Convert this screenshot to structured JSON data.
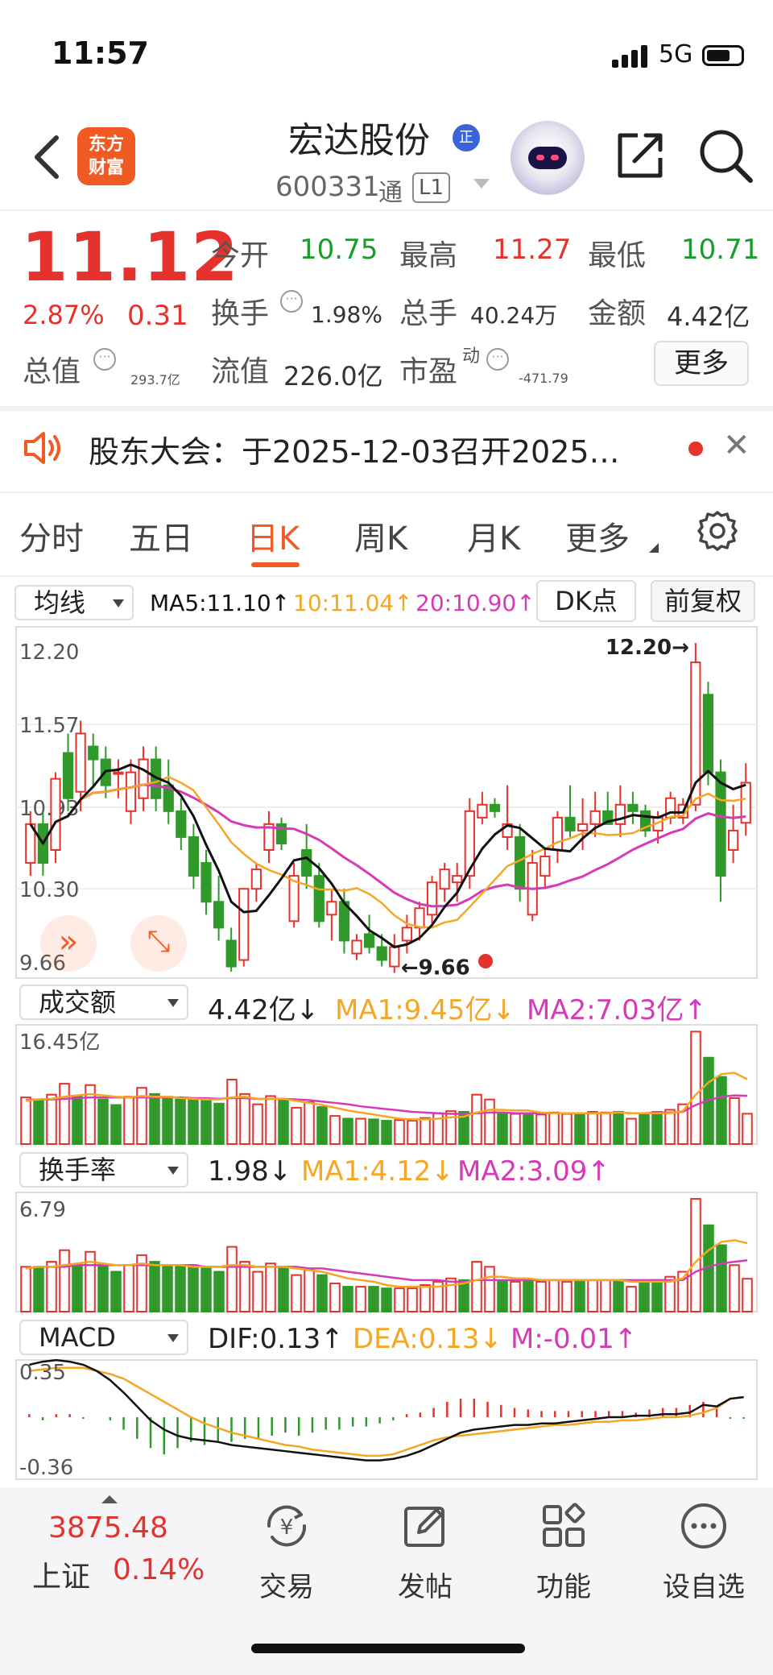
{
  "status_bar": {
    "time": "11:57",
    "network": "5G"
  },
  "header": {
    "logo_text_line1": "东方",
    "logo_text_line2": "财富",
    "stock_name": "宏达股份",
    "badge": "正",
    "stock_code": "600331",
    "tong_label": "通",
    "level_label": "L1"
  },
  "quote": {
    "price": "11.12",
    "change_pct": "2.87%",
    "change_amt": "0.31",
    "open_label": "今开",
    "open_value": "10.75",
    "high_label": "最高",
    "high_value": "11.27",
    "low_label": "最低",
    "low_value": "10.71",
    "turnover_label": "换手",
    "turnover_value": "1.98%",
    "volume_label": "总手",
    "volume_value": "40.24万",
    "amount_label": "金额",
    "amount_value": "4.42亿",
    "mktcap_label": "总值",
    "mktcap_value": "293.7亿",
    "float_label": "流值",
    "float_value": "226.0亿",
    "pe_label": "市盈",
    "pe_sup": "动",
    "pe_value": "-471.79",
    "more_button": "更多"
  },
  "notice": {
    "text": "股东大会：于2025-12-03召开2025…"
  },
  "tabs": [
    {
      "label": "分时",
      "active": false
    },
    {
      "label": "五日",
      "active": false
    },
    {
      "label": "日K",
      "active": true
    },
    {
      "label": "周K",
      "active": false
    },
    {
      "label": "月K",
      "active": false
    },
    {
      "label": "更多",
      "active": false
    }
  ],
  "kline_legend": {
    "selector": "均线",
    "ma5": "MA5:11.10↑",
    "ma10": "10:11.04↑",
    "ma20": "20:10.90↑",
    "dk_button": "DK点",
    "fq_button": "前复权"
  },
  "volume_legend": {
    "selector": "成交额",
    "value": "4.42亿↓",
    "ma1": "MA1:9.45亿↓",
    "ma2": "MA2:7.03亿↑"
  },
  "turnover_legend": {
    "selector": "换手率",
    "value": "1.98↓",
    "ma1": "MA1:4.12↓",
    "ma2": "MA2:3.09↑"
  },
  "macd_legend": {
    "selector": "MACD",
    "dif": "DIF:0.13↑",
    "dea": "DEA:0.13↓",
    "m": "M:-0.01↑"
  },
  "colors": {
    "up": "#e5322d",
    "down": "#2f9a2a",
    "ma5": "#111111",
    "ma10": "#f5a623",
    "ma20": "#d63ab6",
    "accent": "#f25a23"
  },
  "chart_data": [
    {
      "type": "candlestick",
      "y_ticks": [
        "12.20",
        "11.57",
        "10.93",
        "10.30",
        "9.66"
      ],
      "ylim": [
        9.66,
        12.2
      ],
      "annotations": {
        "high": "12.20→",
        "low": "←9.66"
      },
      "candles": [
        {
          "o": 10.5,
          "h": 10.9,
          "l": 10.4,
          "c": 10.8
        },
        {
          "o": 10.8,
          "h": 10.9,
          "l": 10.4,
          "c": 10.5
        },
        {
          "o": 10.6,
          "h": 11.2,
          "l": 10.5,
          "c": 11.15
        },
        {
          "o": 11.35,
          "h": 11.5,
          "l": 10.9,
          "c": 11.0
        },
        {
          "o": 11.05,
          "h": 11.6,
          "l": 10.9,
          "c": 11.5
        },
        {
          "o": 11.4,
          "h": 11.5,
          "l": 11.1,
          "c": 11.3
        },
        {
          "o": 11.3,
          "h": 11.4,
          "l": 11.0,
          "c": 11.1
        },
        {
          "o": 11.2,
          "h": 11.3,
          "l": 11.0,
          "c": 11.2
        },
        {
          "o": 10.9,
          "h": 11.3,
          "l": 10.8,
          "c": 11.2
        },
        {
          "o": 11.0,
          "h": 11.4,
          "l": 10.9,
          "c": 11.3
        },
        {
          "o": 11.3,
          "h": 11.4,
          "l": 10.9,
          "c": 11.0
        },
        {
          "o": 11.1,
          "h": 11.3,
          "l": 10.8,
          "c": 10.9
        },
        {
          "o": 10.9,
          "h": 11.0,
          "l": 10.6,
          "c": 10.7
        },
        {
          "o": 10.7,
          "h": 10.8,
          "l": 10.3,
          "c": 10.4
        },
        {
          "o": 10.5,
          "h": 10.6,
          "l": 10.1,
          "c": 10.2
        },
        {
          "o": 10.2,
          "h": 10.4,
          "l": 9.9,
          "c": 10.0
        },
        {
          "o": 9.9,
          "h": 10.0,
          "l": 9.66,
          "c": 9.7
        },
        {
          "o": 9.75,
          "h": 10.2,
          "l": 9.7,
          "c": 10.3
        },
        {
          "o": 10.3,
          "h": 10.5,
          "l": 10.2,
          "c": 10.45
        },
        {
          "o": 10.6,
          "h": 10.9,
          "l": 10.5,
          "c": 10.8
        },
        {
          "o": 10.8,
          "h": 10.85,
          "l": 10.6,
          "c": 10.65
        },
        {
          "o": 10.05,
          "h": 10.5,
          "l": 10.0,
          "c": 10.4
        },
        {
          "o": 10.6,
          "h": 10.8,
          "l": 10.3,
          "c": 10.4
        },
        {
          "o": 10.4,
          "h": 10.5,
          "l": 10.0,
          "c": 10.05
        },
        {
          "o": 10.1,
          "h": 10.3,
          "l": 9.9,
          "c": 10.2
        },
        {
          "o": 10.2,
          "h": 10.3,
          "l": 9.8,
          "c": 9.9
        },
        {
          "o": 9.8,
          "h": 9.95,
          "l": 9.75,
          "c": 9.9
        },
        {
          "o": 9.95,
          "h": 10.1,
          "l": 9.8,
          "c": 9.85
        },
        {
          "o": 9.85,
          "h": 9.95,
          "l": 9.7,
          "c": 9.75
        },
        {
          "o": 9.7,
          "h": 9.95,
          "l": 9.65,
          "c": 9.85
        },
        {
          "o": 9.9,
          "h": 10.1,
          "l": 9.8,
          "c": 10.0
        },
        {
          "o": 10.0,
          "h": 10.2,
          "l": 9.9,
          "c": 10.15
        },
        {
          "o": 10.1,
          "h": 10.4,
          "l": 10.0,
          "c": 10.35
        },
        {
          "o": 10.3,
          "h": 10.5,
          "l": 10.2,
          "c": 10.45
        },
        {
          "o": 10.35,
          "h": 10.5,
          "l": 10.2,
          "c": 10.4
        },
        {
          "o": 10.4,
          "h": 11.0,
          "l": 10.3,
          "c": 10.9
        },
        {
          "o": 10.85,
          "h": 11.05,
          "l": 10.8,
          "c": 10.95
        },
        {
          "o": 10.95,
          "h": 11.0,
          "l": 10.85,
          "c": 10.9
        },
        {
          "o": 10.7,
          "h": 11.1,
          "l": 10.6,
          "c": 10.8
        },
        {
          "o": 10.7,
          "h": 10.8,
          "l": 10.2,
          "c": 10.3
        },
        {
          "o": 10.1,
          "h": 10.6,
          "l": 10.05,
          "c": 10.5
        },
        {
          "o": 10.4,
          "h": 10.6,
          "l": 10.3,
          "c": 10.55
        },
        {
          "o": 10.6,
          "h": 10.9,
          "l": 10.5,
          "c": 10.85
        },
        {
          "o": 10.85,
          "h": 11.1,
          "l": 10.7,
          "c": 10.75
        },
        {
          "o": 10.75,
          "h": 11.0,
          "l": 10.6,
          "c": 10.8
        },
        {
          "o": 10.8,
          "h": 11.05,
          "l": 10.7,
          "c": 10.9
        },
        {
          "o": 10.9,
          "h": 11.05,
          "l": 10.8,
          "c": 10.8
        },
        {
          "o": 10.8,
          "h": 11.1,
          "l": 10.7,
          "c": 10.95
        },
        {
          "o": 10.95,
          "h": 11.05,
          "l": 10.8,
          "c": 10.9
        },
        {
          "o": 10.9,
          "h": 10.95,
          "l": 10.7,
          "c": 10.75
        },
        {
          "o": 10.75,
          "h": 10.9,
          "l": 10.65,
          "c": 10.85
        },
        {
          "o": 10.85,
          "h": 11.05,
          "l": 10.8,
          "c": 11.0
        },
        {
          "o": 10.85,
          "h": 11.0,
          "l": 10.8,
          "c": 10.95
        },
        {
          "o": 10.95,
          "h": 12.2,
          "l": 10.9,
          "c": 12.05
        },
        {
          "o": 11.8,
          "h": 11.9,
          "l": 11.1,
          "c": 11.2
        },
        {
          "o": 11.2,
          "h": 11.3,
          "l": 10.2,
          "c": 10.4
        },
        {
          "o": 10.6,
          "h": 10.95,
          "l": 10.5,
          "c": 10.75
        },
        {
          "o": 10.81,
          "h": 11.27,
          "l": 10.71,
          "c": 11.12
        }
      ]
    },
    {
      "type": "bar",
      "name": "成交额",
      "y_ticks": [
        "16.45亿"
      ],
      "ymax": 16.45,
      "values": [
        6.8,
        6.5,
        7.2,
        8.8,
        6.9,
        8.6,
        6.5,
        5.7,
        6.9,
        8.2,
        7.3,
        6.9,
        6.5,
        6.7,
        6.6,
        5.9,
        9.4,
        7.3,
        5.8,
        7.0,
        6.5,
        5.3,
        6.1,
        5.4,
        4.1,
        3.7,
        3.7,
        3.6,
        3.4,
        3.5,
        3.4,
        3.8,
        4.5,
        4.8,
        4.7,
        7.2,
        6.5,
        4.5,
        4.4,
        4.5,
        4.3,
        4.6,
        4.4,
        4.5,
        4.7,
        4.6,
        4.7,
        3.7,
        4.4,
        4.7,
        5.0,
        5.8,
        16.4,
        12.6,
        9.8,
        6.7,
        4.42
      ],
      "up": [
        true,
        false,
        true,
        true,
        false,
        true,
        false,
        false,
        true,
        true,
        false,
        false,
        false,
        false,
        false,
        false,
        true,
        true,
        true,
        true,
        false,
        true,
        true,
        false,
        true,
        false,
        true,
        false,
        false,
        true,
        true,
        true,
        true,
        true,
        false,
        true,
        true,
        false,
        true,
        false,
        true,
        true,
        true,
        false,
        true,
        true,
        false,
        true,
        false,
        false,
        true,
        true,
        true,
        false,
        false,
        true,
        true
      ],
      "ma1": [
        6.3,
        6.5,
        6.6,
        6.9,
        7.1,
        7.3,
        7.1,
        6.9,
        6.8,
        7.0,
        6.9,
        6.9,
        6.7,
        6.6,
        6.5,
        6.5,
        6.8,
        6.9,
        6.6,
        6.6,
        6.6,
        6.3,
        6.0,
        5.7,
        5.3,
        4.9,
        4.6,
        4.3,
        4.0,
        3.7,
        3.6,
        3.6,
        3.7,
        3.9,
        4.0,
        4.6,
        5.0,
        5.0,
        4.9,
        4.9,
        4.6,
        4.5,
        4.5,
        4.5,
        4.5,
        4.5,
        4.6,
        4.5,
        4.5,
        4.5,
        4.5,
        4.8,
        7.2,
        9.0,
        10.2,
        10.4,
        9.45
      ],
      "ma2": [
        6.4,
        6.5,
        6.5,
        6.6,
        6.7,
        6.8,
        6.8,
        6.8,
        6.8,
        6.8,
        6.8,
        6.8,
        6.8,
        6.7,
        6.7,
        6.6,
        6.7,
        6.7,
        6.6,
        6.6,
        6.6,
        6.5,
        6.4,
        6.2,
        6.0,
        5.8,
        5.5,
        5.3,
        5.1,
        4.9,
        4.7,
        4.6,
        4.5,
        4.4,
        4.4,
        4.5,
        4.6,
        4.6,
        4.5,
        4.5,
        4.5,
        4.5,
        4.5,
        4.5,
        4.5,
        4.5,
        4.6,
        4.5,
        4.5,
        4.6,
        4.6,
        4.7,
        5.7,
        6.4,
        6.9,
        7.1,
        7.03
      ]
    },
    {
      "type": "bar",
      "name": "换手率",
      "y_ticks": [
        "6.79"
      ],
      "ymax": 6.79,
      "values": [
        2.7,
        2.7,
        3.0,
        3.7,
        2.8,
        3.6,
        2.7,
        2.4,
        2.8,
        3.4,
        3.0,
        2.8,
        2.7,
        2.8,
        2.7,
        2.4,
        3.9,
        3.0,
        2.4,
        2.9,
        2.7,
        2.2,
        2.5,
        2.2,
        1.7,
        1.5,
        1.5,
        1.5,
        1.4,
        1.4,
        1.4,
        1.6,
        1.8,
        2.0,
        1.9,
        3.0,
        2.7,
        1.8,
        1.8,
        1.8,
        1.8,
        1.9,
        1.8,
        1.8,
        1.9,
        1.9,
        1.9,
        1.5,
        1.8,
        1.9,
        2.1,
        2.4,
        6.79,
        5.2,
        4.0,
        2.8,
        1.98
      ],
      "up": [
        true,
        false,
        true,
        true,
        false,
        true,
        false,
        false,
        true,
        true,
        false,
        false,
        false,
        false,
        false,
        false,
        true,
        true,
        true,
        true,
        false,
        true,
        true,
        false,
        true,
        false,
        true,
        false,
        false,
        true,
        true,
        true,
        true,
        true,
        false,
        true,
        true,
        false,
        true,
        false,
        true,
        true,
        true,
        false,
        true,
        true,
        false,
        true,
        false,
        false,
        true,
        true,
        true,
        false,
        false,
        true,
        true
      ],
      "ma1": [
        2.6,
        2.7,
        2.7,
        2.8,
        2.9,
        3.0,
        2.9,
        2.8,
        2.8,
        2.9,
        2.8,
        2.8,
        2.8,
        2.7,
        2.7,
        2.7,
        2.8,
        2.8,
        2.7,
        2.7,
        2.7,
        2.6,
        2.5,
        2.4,
        2.2,
        2.0,
        1.9,
        1.8,
        1.6,
        1.5,
        1.5,
        1.5,
        1.5,
        1.6,
        1.7,
        1.9,
        2.1,
        2.1,
        2.0,
        2.0,
        1.9,
        1.9,
        1.9,
        1.9,
        1.9,
        1.9,
        1.9,
        1.8,
        1.8,
        1.8,
        1.8,
        2.0,
        3.0,
        3.7,
        4.2,
        4.3,
        4.12
      ],
      "ma2": [
        2.6,
        2.7,
        2.7,
        2.7,
        2.8,
        2.8,
        2.8,
        2.8,
        2.8,
        2.8,
        2.8,
        2.8,
        2.8,
        2.8,
        2.7,
        2.7,
        2.7,
        2.7,
        2.7,
        2.7,
        2.7,
        2.7,
        2.6,
        2.6,
        2.5,
        2.4,
        2.3,
        2.2,
        2.1,
        2.0,
        1.9,
        1.9,
        1.9,
        1.8,
        1.8,
        1.9,
        1.9,
        1.9,
        1.9,
        1.9,
        1.9,
        1.9,
        1.9,
        1.9,
        1.9,
        1.9,
        1.9,
        1.9,
        1.9,
        1.9,
        1.9,
        1.9,
        2.4,
        2.7,
        2.9,
        3.0,
        3.09
      ]
    },
    {
      "type": "macd",
      "y_ticks": [
        "0.35",
        "-0.36"
      ],
      "ylim": [
        -0.36,
        0.35
      ],
      "dif": [
        0.34,
        0.36,
        0.37,
        0.36,
        0.34,
        0.3,
        0.24,
        0.16,
        0.07,
        -0.02,
        -0.08,
        -0.12,
        -0.14,
        -0.15,
        -0.16,
        -0.18,
        -0.19,
        -0.2,
        -0.21,
        -0.22,
        -0.23,
        -0.24,
        -0.25,
        -0.26,
        -0.27,
        -0.28,
        -0.28,
        -0.27,
        -0.25,
        -0.22,
        -0.18,
        -0.14,
        -0.1,
        -0.08,
        -0.07,
        -0.06,
        -0.05,
        -0.05,
        -0.04,
        -0.04,
        -0.03,
        -0.02,
        -0.01,
        0.0,
        0.0,
        0.01,
        0.01,
        0.02,
        0.02,
        0.03,
        0.08,
        0.07,
        0.12,
        0.13
      ],
      "dea": [
        0.3,
        0.31,
        0.32,
        0.32,
        0.32,
        0.3,
        0.28,
        0.25,
        0.2,
        0.15,
        0.1,
        0.05,
        0.0,
        -0.04,
        -0.07,
        -0.1,
        -0.12,
        -0.14,
        -0.16,
        -0.18,
        -0.19,
        -0.21,
        -0.22,
        -0.23,
        -0.24,
        -0.25,
        -0.25,
        -0.24,
        -0.21,
        -0.18,
        -0.15,
        -0.13,
        -0.12,
        -0.11,
        -0.1,
        -0.09,
        -0.08,
        -0.07,
        -0.06,
        -0.05,
        -0.05,
        -0.04,
        -0.03,
        -0.03,
        -0.02,
        -0.02,
        -0.01,
        0.0,
        0.0,
        0.01,
        0.03,
        0.06,
        0.12,
        0.13
      ],
      "m": [
        0.02,
        -0.02,
        0.02,
        0.02,
        -0.01,
        0.0,
        -0.02,
        -0.08,
        -0.14,
        -0.2,
        -0.24,
        -0.2,
        -0.16,
        -0.18,
        -0.16,
        -0.16,
        -0.14,
        -0.14,
        -0.12,
        -0.1,
        -0.12,
        -0.1,
        -0.08,
        -0.08,
        -0.06,
        -0.06,
        -0.04,
        -0.02,
        0.02,
        0.03,
        0.06,
        0.1,
        0.12,
        0.12,
        0.1,
        0.08,
        0.06,
        0.05,
        0.04,
        0.04,
        0.04,
        0.04,
        0.04,
        0.04,
        0.04,
        0.03,
        0.05,
        0.06,
        0.06,
        0.08,
        0.1,
        0.06,
        -0.01,
        -0.01
      ]
    }
  ],
  "bottom_nav": {
    "index_value": "3875.48",
    "index_name": "上证",
    "index_pct": "0.14%",
    "items": [
      {
        "label": "交易",
        "icon": "trade-icon"
      },
      {
        "label": "发帖",
        "icon": "post-icon"
      },
      {
        "label": "功能",
        "icon": "function-icon"
      },
      {
        "label": "设自选",
        "icon": "watchlist-icon"
      }
    ]
  }
}
